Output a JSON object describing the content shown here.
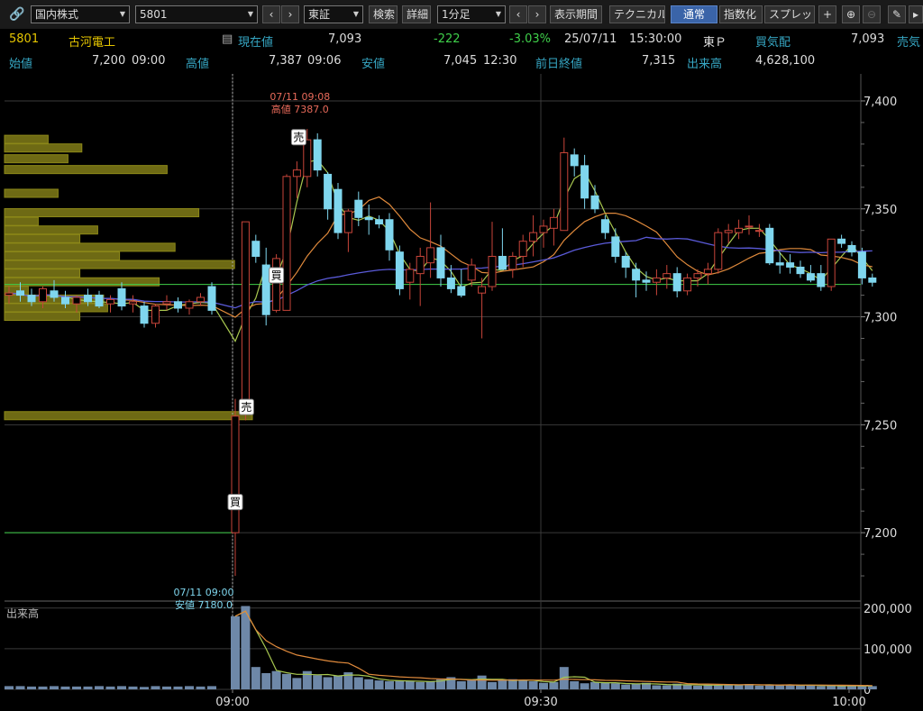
{
  "toolbar": {
    "market": "国内株式",
    "code": "5801",
    "exchange": "東証",
    "search_label": "検索",
    "detail_label": "詳細",
    "interval": "1分足",
    "display_period_label": "表示期間",
    "technical_label": "テクニカル",
    "normal_label": "通常",
    "index_label": "指数化",
    "spread_label": "スプレッド"
  },
  "quote": {
    "code": "5801",
    "name": "古河電工",
    "current_label": "現在値",
    "current": "7,093",
    "change": "-222",
    "change_pct": "-3.03%",
    "date": "25/07/11",
    "time": "15:30:00",
    "market_label": "東Ｐ",
    "bid_label": "買気配",
    "bid": "7,093",
    "ask_label": "売気",
    "open_label": "始値",
    "open": "7,200",
    "open_time": "09:00",
    "high_label": "高値",
    "high": "7,387",
    "high_time": "09:06",
    "low_label": "安値",
    "low": "7,045",
    "low_time": "12:30",
    "prev_close_label": "前日終値",
    "prev_close": "7,315",
    "volume_label": "出来高",
    "volume": "4,628,100"
  },
  "colors": {
    "up": "#c8453a",
    "down": "#7fd6ee",
    "grid": "#3a3a3a",
    "ma_short": "#a8c850",
    "ma_mid": "#e08a3c",
    "ma_long": "#5a5ad8",
    "prev_close_line": "#3fd04a",
    "volume_profile": "#6e6a14"
  },
  "chart_data": {
    "type": "candlestick",
    "price_axis": {
      "ylim": [
        7170,
        7405
      ],
      "ticks": [
        "7,400",
        "7,350",
        "7,300",
        "7,250",
        "7,200"
      ]
    },
    "volume_axis": {
      "label": "出来高",
      "ylim": [
        0,
        215000
      ],
      "ticks": [
        "200,000",
        "100,000",
        "0"
      ]
    },
    "x_ticks": [
      "09:00",
      "09:30",
      "10:00"
    ],
    "annotations": {
      "high": {
        "date_time": "07/11 09:08",
        "text": "高値 7387.0"
      },
      "low": {
        "date_time": "07/11 09:00",
        "text": "安値 7180.0"
      },
      "markers": [
        {
          "text": "売",
          "price": 7383
        },
        {
          "text": "売",
          "price": 7258
        },
        {
          "text": "買",
          "price": 7214
        },
        {
          "text": "買",
          "price": 7319
        }
      ]
    },
    "reference_lines": [
      7315,
      7200
    ],
    "volume_profile": [
      {
        "price": 7382,
        "vol": 0.22
      },
      {
        "price": 7378,
        "vol": 0.39
      },
      {
        "price": 7373,
        "vol": 0.32
      },
      {
        "price": 7368,
        "vol": 0.82
      },
      {
        "price": 7357,
        "vol": 0.27
      },
      {
        "price": 7348,
        "vol": 0.98
      },
      {
        "price": 7344,
        "vol": 0.17
      },
      {
        "price": 7340,
        "vol": 0.47
      },
      {
        "price": 7336,
        "vol": 0.38
      },
      {
        "price": 7332,
        "vol": 0.86
      },
      {
        "price": 7328,
        "vol": 0.58
      },
      {
        "price": 7324,
        "vol": 1.16
      },
      {
        "price": 7320,
        "vol": 0.38
      },
      {
        "price": 7316,
        "vol": 0.78
      },
      {
        "price": 7312,
        "vol": 0.12
      },
      {
        "price": 7308,
        "vol": 0.5
      },
      {
        "price": 7304,
        "vol": 0.52
      },
      {
        "price": 7300,
        "vol": 0.38
      },
      {
        "price": 7254,
        "vol": 1.25
      }
    ],
    "pre_open": [
      {
        "o": 7310,
        "h": 7314,
        "l": 7306,
        "c": 7311
      },
      {
        "o": 7312,
        "h": 7316,
        "l": 7307,
        "c": 7310
      },
      {
        "o": 7310,
        "h": 7313,
        "l": 7305,
        "c": 7307
      },
      {
        "o": 7307,
        "h": 7314,
        "l": 7304,
        "c": 7313
      },
      {
        "o": 7312,
        "h": 7317,
        "l": 7307,
        "c": 7309
      },
      {
        "o": 7309,
        "h": 7312,
        "l": 7304,
        "c": 7306
      },
      {
        "o": 7306,
        "h": 7310,
        "l": 7302,
        "c": 7309
      },
      {
        "o": 7310,
        "h": 7313,
        "l": 7305,
        "c": 7307
      },
      {
        "o": 7310,
        "h": 7312,
        "l": 7304,
        "c": 7305
      },
      {
        "o": 7306,
        "h": 7310,
        "l": 7302,
        "c": 7308
      },
      {
        "o": 7313,
        "h": 7316,
        "l": 7303,
        "c": 7305
      },
      {
        "o": 7306,
        "h": 7310,
        "l": 7302,
        "c": 7307
      },
      {
        "o": 7305,
        "h": 7307,
        "l": 7295,
        "c": 7297
      },
      {
        "o": 7297,
        "h": 7306,
        "l": 7295,
        "c": 7305
      },
      {
        "o": 7306,
        "h": 7310,
        "l": 7303,
        "c": 7307
      },
      {
        "o": 7307,
        "h": 7309,
        "l": 7302,
        "c": 7304
      },
      {
        "o": 7304,
        "h": 7308,
        "l": 7301,
        "c": 7307
      },
      {
        "o": 7307,
        "h": 7311,
        "l": 7305,
        "c": 7309
      },
      {
        "o": 7314,
        "h": 7316,
        "l": 7301,
        "c": 7303
      }
    ],
    "candles": [
      {
        "o": 7200,
        "h": 7262,
        "l": 7180,
        "c": 7254
      },
      {
        "o": 7258,
        "h": 7344,
        "l": 7252,
        "c": 7344
      },
      {
        "o": 7335,
        "h": 7338,
        "l": 7325,
        "c": 7328
      },
      {
        "o": 7324,
        "h": 7332,
        "l": 7296,
        "c": 7301
      },
      {
        "o": 7303,
        "h": 7329,
        "l": 7302,
        "c": 7327
      },
      {
        "o": 7303,
        "h": 7366,
        "l": 7303,
        "c": 7365
      },
      {
        "o": 7365,
        "h": 7372,
        "l": 7355,
        "c": 7368
      },
      {
        "o": 7365,
        "h": 7387,
        "l": 7360,
        "c": 7382
      },
      {
        "o": 7382,
        "h": 7385,
        "l": 7365,
        "c": 7368
      },
      {
        "o": 7366,
        "h": 7367,
        "l": 7345,
        "c": 7350
      },
      {
        "o": 7359,
        "h": 7362,
        "l": 7336,
        "c": 7339
      },
      {
        "o": 7339,
        "h": 7350,
        "l": 7330,
        "c": 7349
      },
      {
        "o": 7354,
        "h": 7358,
        "l": 7342,
        "c": 7346
      },
      {
        "o": 7346,
        "h": 7352,
        "l": 7338,
        "c": 7345
      },
      {
        "o": 7345,
        "h": 7347,
        "l": 7341,
        "c": 7343
      },
      {
        "o": 7345,
        "h": 7348,
        "l": 7326,
        "c": 7331
      },
      {
        "o": 7330,
        "h": 7333,
        "l": 7310,
        "c": 7313
      },
      {
        "o": 7316,
        "h": 7325,
        "l": 7308,
        "c": 7322
      },
      {
        "o": 7320,
        "h": 7332,
        "l": 7305,
        "c": 7328
      },
      {
        "o": 7325,
        "h": 7353,
        "l": 7318,
        "c": 7332
      },
      {
        "o": 7332,
        "h": 7338,
        "l": 7314,
        "c": 7318
      },
      {
        "o": 7318,
        "h": 7324,
        "l": 7311,
        "c": 7313
      },
      {
        "o": 7314,
        "h": 7322,
        "l": 7309,
        "c": 7310
      },
      {
        "o": 7317,
        "h": 7327,
        "l": 7314,
        "c": 7324
      },
      {
        "o": 7311,
        "h": 7318,
        "l": 7290,
        "c": 7314
      },
      {
        "o": 7314,
        "h": 7344,
        "l": 7312,
        "c": 7328
      },
      {
        "o": 7328,
        "h": 7341,
        "l": 7322,
        "c": 7322
      },
      {
        "o": 7322,
        "h": 7330,
        "l": 7318,
        "c": 7328
      },
      {
        "o": 7328,
        "h": 7338,
        "l": 7323,
        "c": 7335
      },
      {
        "o": 7335,
        "h": 7347,
        "l": 7328,
        "c": 7339
      },
      {
        "o": 7339,
        "h": 7345,
        "l": 7332,
        "c": 7342
      },
      {
        "o": 7341,
        "h": 7350,
        "l": 7333,
        "c": 7346
      },
      {
        "o": 7340,
        "h": 7383,
        "l": 7340,
        "c": 7376
      },
      {
        "o": 7375,
        "h": 7378,
        "l": 7365,
        "c": 7370
      },
      {
        "o": 7370,
        "h": 7375,
        "l": 7350,
        "c": 7355
      },
      {
        "o": 7356,
        "h": 7361,
        "l": 7348,
        "c": 7350
      },
      {
        "o": 7345,
        "h": 7347,
        "l": 7336,
        "c": 7339
      },
      {
        "o": 7337,
        "h": 7341,
        "l": 7325,
        "c": 7328
      },
      {
        "o": 7328,
        "h": 7330,
        "l": 7318,
        "c": 7323
      },
      {
        "o": 7322,
        "h": 7325,
        "l": 7309,
        "c": 7317
      },
      {
        "o": 7317,
        "h": 7321,
        "l": 7312,
        "c": 7316
      },
      {
        "o": 7316,
        "h": 7322,
        "l": 7310,
        "c": 7318
      },
      {
        "o": 7318,
        "h": 7324,
        "l": 7313,
        "c": 7320
      },
      {
        "o": 7320,
        "h": 7323,
        "l": 7309,
        "c": 7312
      },
      {
        "o": 7312,
        "h": 7320,
        "l": 7310,
        "c": 7318
      },
      {
        "o": 7318,
        "h": 7322,
        "l": 7314,
        "c": 7320
      },
      {
        "o": 7320,
        "h": 7325,
        "l": 7315,
        "c": 7322
      },
      {
        "o": 7322,
        "h": 7341,
        "l": 7320,
        "c": 7339
      },
      {
        "o": 7339,
        "h": 7343,
        "l": 7334,
        "c": 7340
      },
      {
        "o": 7339,
        "h": 7345,
        "l": 7336,
        "c": 7341
      },
      {
        "o": 7342,
        "h": 7347,
        "l": 7338,
        "c": 7342
      },
      {
        "o": 7340,
        "h": 7343,
        "l": 7337,
        "c": 7340
      },
      {
        "o": 7341,
        "h": 7343,
        "l": 7324,
        "c": 7325
      },
      {
        "o": 7325,
        "h": 7330,
        "l": 7320,
        "c": 7324
      },
      {
        "o": 7325,
        "h": 7329,
        "l": 7320,
        "c": 7323
      },
      {
        "o": 7323,
        "h": 7326,
        "l": 7318,
        "c": 7320
      },
      {
        "o": 7320,
        "h": 7324,
        "l": 7316,
        "c": 7317
      },
      {
        "o": 7320,
        "h": 7324,
        "l": 7312,
        "c": 7314
      },
      {
        "o": 7314,
        "h": 7336,
        "l": 7312,
        "c": 7336
      },
      {
        "o": 7336,
        "h": 7338,
        "l": 7332,
        "c": 7334
      },
      {
        "o": 7333,
        "h": 7335,
        "l": 7328,
        "c": 7330
      },
      {
        "o": 7330,
        "h": 7332,
        "l": 7315,
        "c": 7318
      },
      {
        "o": 7318,
        "h": 7320,
        "l": 7314,
        "c": 7316
      }
    ],
    "volumes": [
      180000,
      205000,
      55000,
      40000,
      45000,
      38000,
      28000,
      45000,
      35000,
      30000,
      34000,
      42000,
      30000,
      25000,
      22000,
      20000,
      22000,
      20000,
      18000,
      20000,
      24000,
      30000,
      20000,
      22000,
      34000,
      18000,
      22000,
      25000,
      22000,
      20000,
      16000,
      18000,
      55000,
      20000,
      15000,
      18000,
      16000,
      15000,
      12000,
      14000,
      16000,
      10000,
      10000,
      14000,
      10000,
      9000,
      12000,
      10000,
      12000,
      10000,
      13000,
      9000,
      12000,
      10000,
      11000,
      9000,
      11000,
      8000,
      10000,
      8000,
      9000,
      8000,
      8000
    ],
    "pre_volumes": [
      8000,
      8000,
      7000,
      7000,
      8000,
      7000,
      7000,
      7000,
      8000,
      7000,
      8000,
      7000,
      6000,
      8000,
      7000,
      7000,
      8000,
      7000,
      8000
    ]
  }
}
